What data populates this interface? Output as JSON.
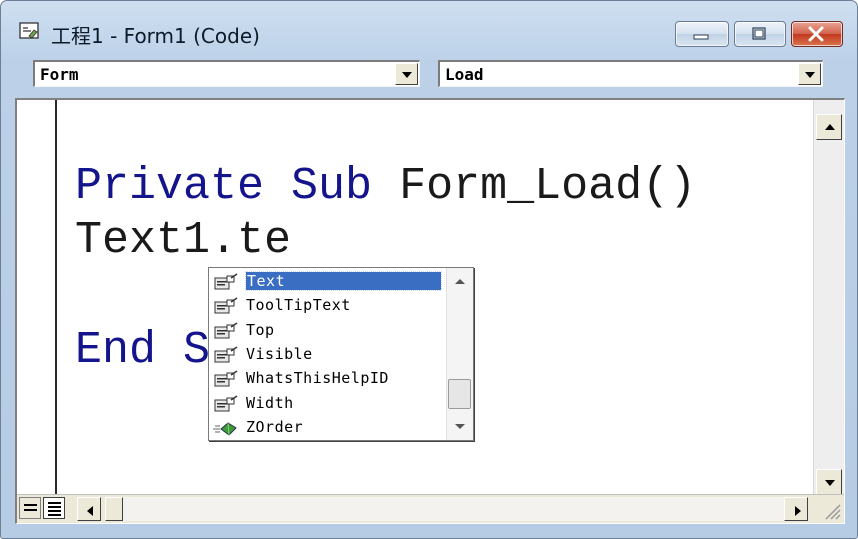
{
  "window": {
    "title": "工程1 - Form1 (Code)"
  },
  "combos": {
    "object_value": "Form",
    "procedure_value": "Load"
  },
  "code": {
    "line1_keywords": "Private Sub ",
    "line1_rest": "Form_Load()",
    "line2": "Text1.te",
    "line3_keyword": "End S"
  },
  "autocomplete": {
    "items": [
      {
        "label": "Text",
        "icon": "property-icon",
        "selected": true
      },
      {
        "label": "ToolTipText",
        "icon": "property-icon"
      },
      {
        "label": "Top",
        "icon": "property-icon"
      },
      {
        "label": "Visible",
        "icon": "property-icon"
      },
      {
        "label": "WhatsThisHelpID",
        "icon": "property-icon"
      },
      {
        "label": "Width",
        "icon": "property-icon"
      },
      {
        "label": "ZOrder",
        "icon": "method-icon"
      }
    ]
  },
  "colors": {
    "keyword": "#14148c",
    "selection": "#3a6ec2",
    "close_button": "#c4391f"
  }
}
